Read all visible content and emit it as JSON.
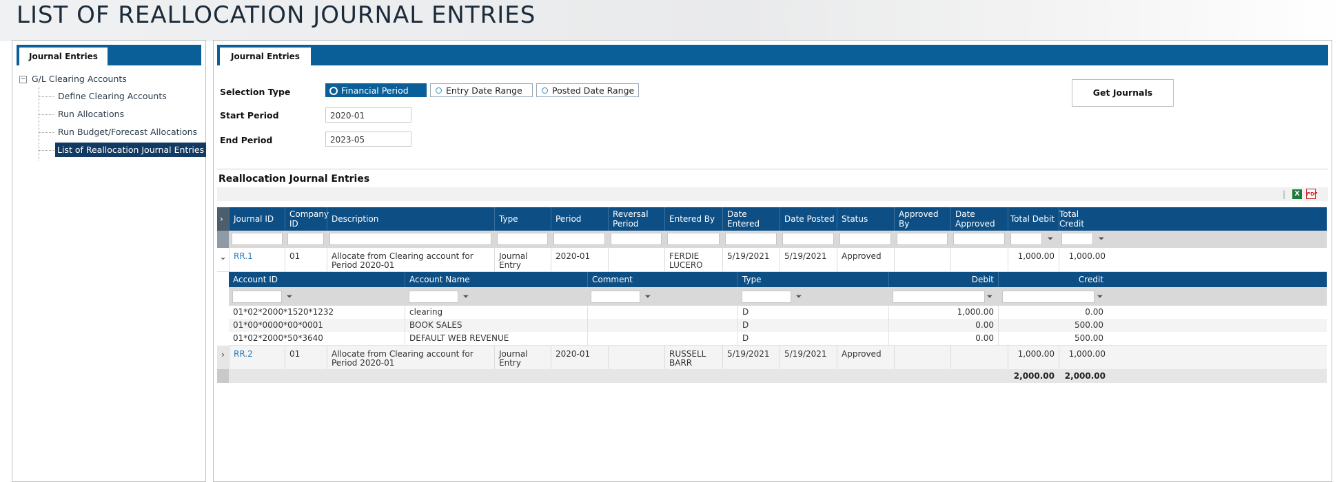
{
  "page": {
    "title": "LIST OF REALLOCATION JOURNAL ENTRIES"
  },
  "left_panel": {
    "tab_label": "Journal Entries",
    "tree_root": "G/L Clearing Accounts",
    "tree_items": [
      "Define Clearing Accounts",
      "Run Allocations",
      "Run Budget/Forecast Allocations",
      "List of Reallocation Journal Entries"
    ],
    "selected_item": "List of Reallocation Journal Entries"
  },
  "right_panel": {
    "tab_label": "Journal Entries",
    "selection_type_label": "Selection Type",
    "selection_options": [
      "Financial Period",
      "Entry Date Range",
      "Posted Date Range"
    ],
    "selected_option": "Financial Period",
    "start_period_label": "Start Period",
    "start_period_value": "2020-01",
    "end_period_label": "End Period",
    "end_period_value": "2023-05",
    "get_journals_label": "Get Journals",
    "section_title": "Reallocation Journal Entries",
    "toolbar_separator": "|",
    "excel_icon": "excel-export-icon",
    "pdf_icon": "pdf-export-icon"
  },
  "grid": {
    "columns": [
      "Journal ID",
      "Company ID",
      "Description",
      "Type",
      "Period",
      "Reversal Period",
      "Entered By",
      "Date Entered",
      "Date Posted",
      "Status",
      "Approved By",
      "Date Approved",
      "Total Debit",
      "Total Credit"
    ],
    "rows": [
      {
        "journal_id": "RR.1",
        "company_id": "01",
        "description": "Allocate from Clearing account for Period 2020-01",
        "type": "Journal Entry",
        "period": "2020-01",
        "reversal_period": "",
        "entered_by": "FERDIE LUCERO",
        "date_entered": "5/19/2021",
        "date_posted": "5/19/2021",
        "status": "Approved",
        "approved_by": "",
        "date_approved": "",
        "total_debit": "1,000.00",
        "total_credit": "1,000.00",
        "expanded": true
      },
      {
        "journal_id": "RR.2",
        "company_id": "01",
        "description": "Allocate from Clearing account for Period 2020-01",
        "type": "Journal Entry",
        "period": "2020-01",
        "reversal_period": "",
        "entered_by": "RUSSELL BARR",
        "date_entered": "5/19/2021",
        "date_posted": "5/19/2021",
        "status": "Approved",
        "approved_by": "",
        "date_approved": "",
        "total_debit": "1,000.00",
        "total_credit": "1,000.00",
        "expanded": false
      }
    ],
    "totals": {
      "total_debit": "2,000.00",
      "total_credit": "2,000.00"
    }
  },
  "detail": {
    "columns": [
      "Account ID",
      "Account Name",
      "Comment",
      "Type",
      "Debit",
      "Credit"
    ],
    "rows": [
      {
        "account_id": "01*02*2000*1520*1232",
        "account_name": "clearing",
        "comment": "",
        "type": "D",
        "debit": "1,000.00",
        "credit": "0.00"
      },
      {
        "account_id": "01*00*0000*00*0001",
        "account_name": "BOOK SALES",
        "comment": "",
        "type": "D",
        "debit": "0.00",
        "credit": "500.00"
      },
      {
        "account_id": "01*02*2000*50*3640",
        "account_name": "DEFAULT WEB REVENUE",
        "comment": "",
        "type": "D",
        "debit": "0.00",
        "credit": "500.00"
      }
    ]
  },
  "icons": {
    "expand_collapsed": "›",
    "expand_open": "⌄",
    "filter": "⏷",
    "tree_toggle": "−"
  }
}
